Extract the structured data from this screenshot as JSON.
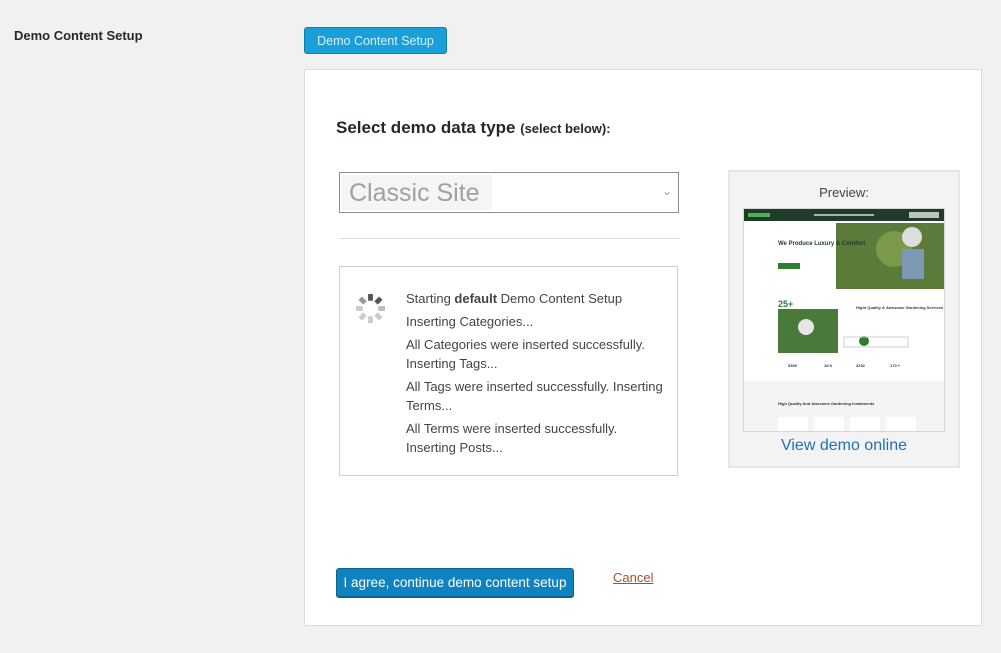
{
  "row_label": "Demo Content Setup",
  "top_button": "Demo Content Setup",
  "heading": {
    "main": "Select demo data type",
    "sub": "(select below):"
  },
  "select": {
    "value": "Classic Site"
  },
  "log": {
    "lines": [
      {
        "pre": "Starting ",
        "bold": "default",
        "post": " Demo Content Setup"
      },
      {
        "text": "Inserting Categories..."
      },
      {
        "text": "All Categories were inserted successfully. Inserting Tags..."
      },
      {
        "text": "All Tags were inserted successfully. Inserting Terms..."
      },
      {
        "text": "All Terms were inserted successfully. Inserting Posts..."
      }
    ]
  },
  "preview": {
    "label": "Preview:",
    "link": "View demo online",
    "thumb": {
      "hero": "We Produce Luxury & Comfort",
      "stat": "25+",
      "services": "Hight Quality & Awesome Gardening Services",
      "counters": [
        "5369",
        "18 K",
        "3292",
        "170 +"
      ],
      "bottom": "High Quality And Awesome Gardening Instalments"
    }
  },
  "actions": {
    "agree": "I agree, continue demo content setup",
    "cancel": "Cancel"
  },
  "colors": {
    "primary": "#0f83c0",
    "link": "#2271b1",
    "cancel": "#a0522d",
    "accent_green": "#3a9a3a"
  }
}
